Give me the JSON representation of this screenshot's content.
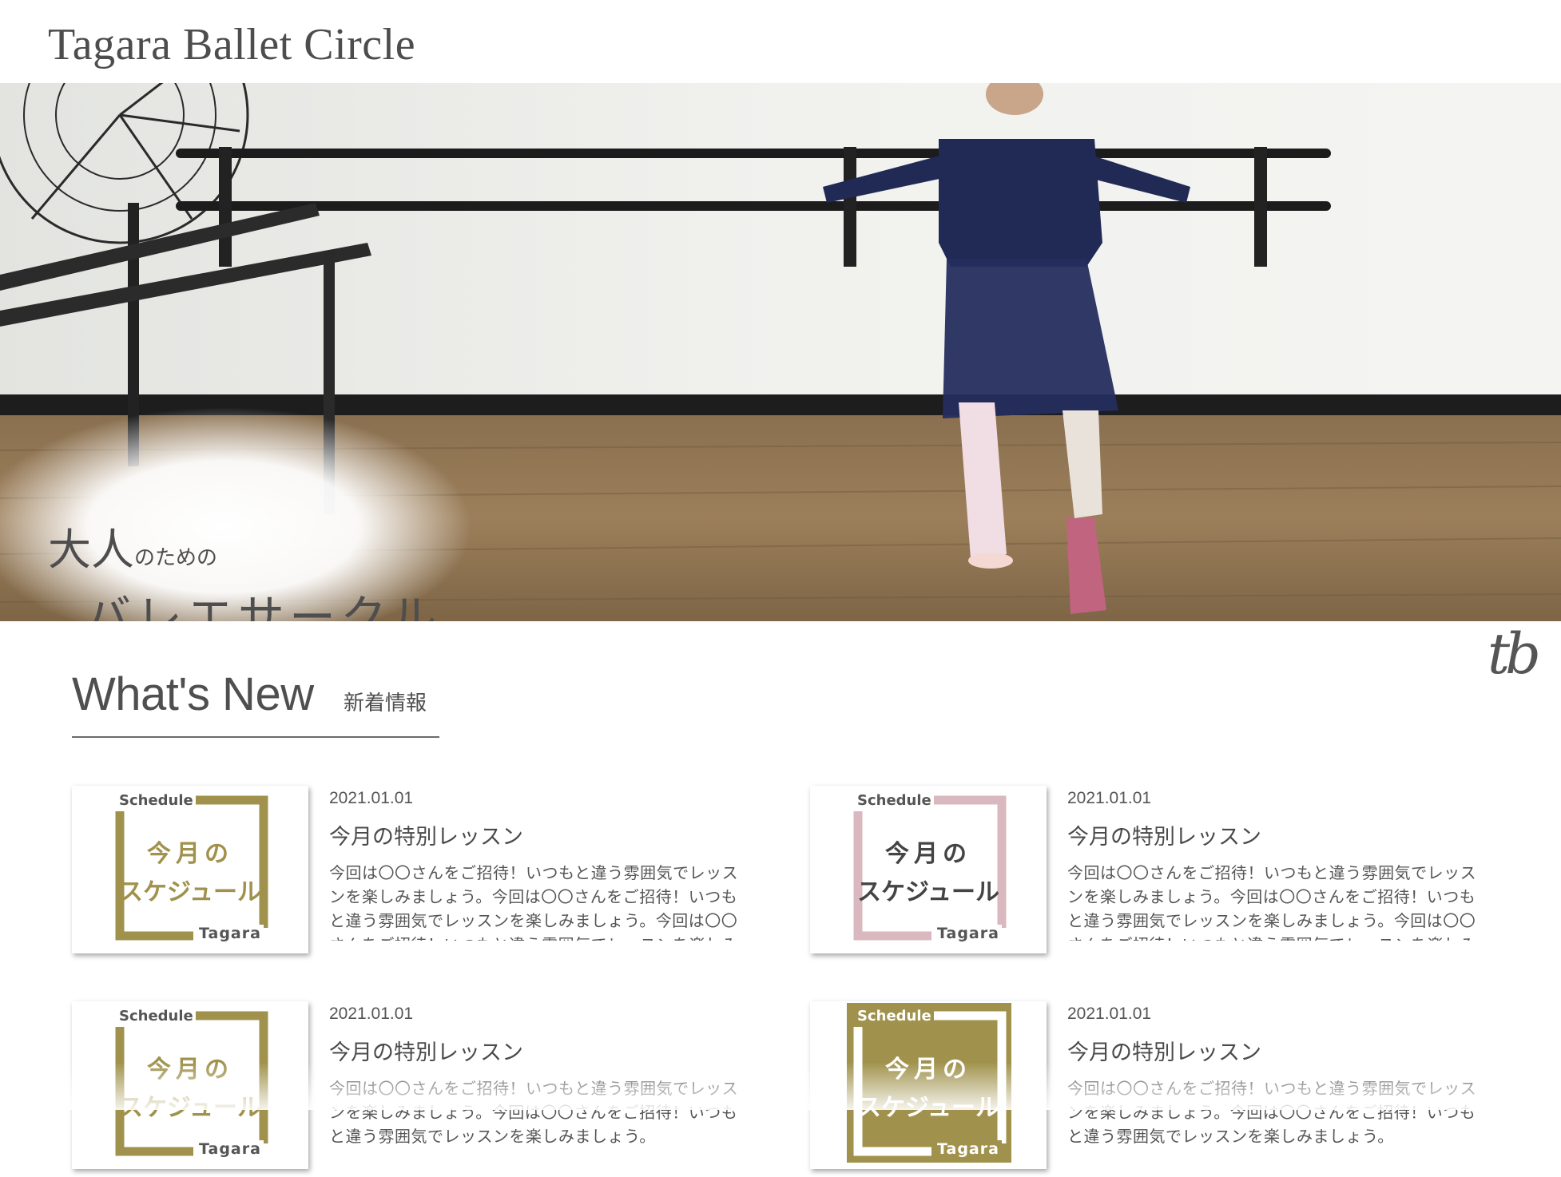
{
  "header": {
    "site_title": "Tagara Ballet Circle"
  },
  "hero": {
    "caption_big": "大人",
    "caption_small": "のための",
    "caption_line2": "バレエサークル"
  },
  "logo": {
    "text": "tb"
  },
  "news": {
    "heading": "What's New",
    "subheading": "新着情報",
    "thumb": {
      "top_label": "Schedule",
      "line1": "今月の",
      "line2": "スケジュール",
      "bottom_label": "Tagara"
    },
    "items": [
      {
        "date": "2021.01.01",
        "title": "今月の特別レッスン",
        "text": "今回は〇〇さんをご招待！いつもと違う雰囲気でレッスンを楽しみましょう。今回は〇〇さんをご招待！いつもと違う雰囲気でレッスンを楽しみましょう。今回は〇〇さんをご招待！いつもと違う雰囲気でレッスンを楽しみましょう。",
        "accent": "#a0924c",
        "style": "outline"
      },
      {
        "date": "2021.01.01",
        "title": "今月の特別レッスン",
        "text": "今回は〇〇さんをご招待！いつもと違う雰囲気でレッスンを楽しみましょう。今回は〇〇さんをご招待！いつもと違う雰囲気でレッスンを楽しみましょう。今回は〇〇さんをご招待！いつもと違う雰囲気でレッスンを楽しみましょう。",
        "accent": "#d9b8bf",
        "style": "outline"
      },
      {
        "date": "2021.01.01",
        "title": "今月の特別レッスン",
        "text": "今回は〇〇さんをご招待！いつもと違う雰囲気でレッスンを楽しみましょう。今回は〇〇さんをご招待！いつもと違う雰囲気でレッスンを楽しみましょう。",
        "accent": "#a0924c",
        "style": "outline"
      },
      {
        "date": "2021.01.01",
        "title": "今月の特別レッスン",
        "text": "今回は〇〇さんをご招待！いつもと違う雰囲気でレッスンを楽しみましょう。今回は〇〇さんをご招待！いつもと違う雰囲気でレッスンを楽しみましょう。",
        "accent": "#a0924c",
        "style": "filled"
      }
    ]
  }
}
